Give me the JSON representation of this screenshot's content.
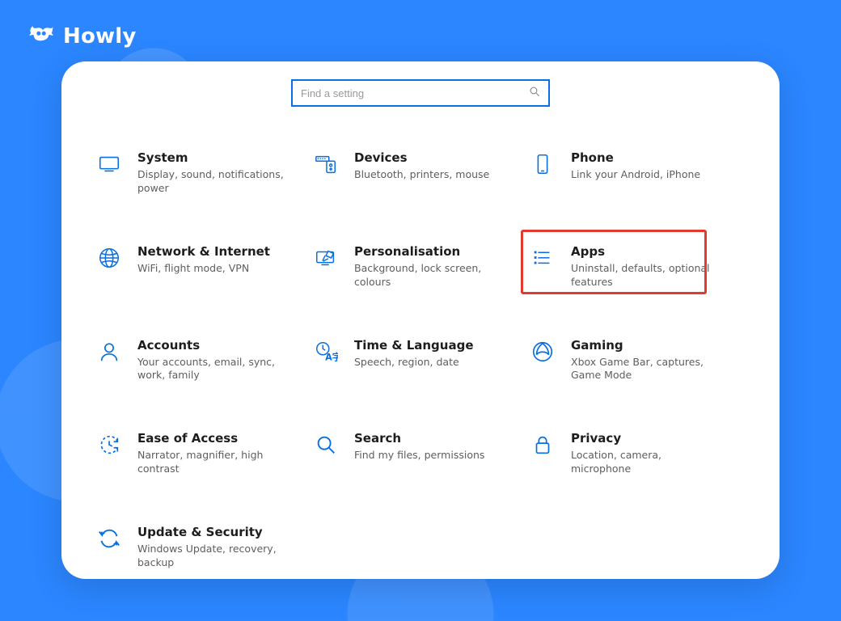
{
  "brand": {
    "name": "Howly"
  },
  "search": {
    "placeholder": "Find a setting"
  },
  "tiles": {
    "system": {
      "title": "System",
      "desc": "Display, sound, notifications, power"
    },
    "devices": {
      "title": "Devices",
      "desc": "Bluetooth, printers, mouse"
    },
    "phone": {
      "title": "Phone",
      "desc": "Link your Android, iPhone"
    },
    "network": {
      "title": "Network & Internet",
      "desc": "WiFi, flight mode, VPN"
    },
    "personal": {
      "title": "Personalisation",
      "desc": "Background, lock screen, colours"
    },
    "apps": {
      "title": "Apps",
      "desc": "Uninstall, defaults, optional features"
    },
    "accounts": {
      "title": "Accounts",
      "desc": "Your accounts, email, sync, work, family"
    },
    "time": {
      "title": "Time & Language",
      "desc": "Speech, region, date"
    },
    "gaming": {
      "title": "Gaming",
      "desc": "Xbox Game Bar, captures, Game Mode"
    },
    "ease": {
      "title": "Ease of Access",
      "desc": "Narrator, magnifier, high contrast"
    },
    "searchCat": {
      "title": "Search",
      "desc": "Find my files, permissions"
    },
    "privacy": {
      "title": "Privacy",
      "desc": "Location, camera, microphone"
    },
    "update": {
      "title": "Update & Security",
      "desc": "Windows Update, recovery, backup"
    }
  },
  "colors": {
    "accent": "#0a6fe0",
    "highlight": "#e33a2f",
    "bg": "#2b86ff"
  }
}
